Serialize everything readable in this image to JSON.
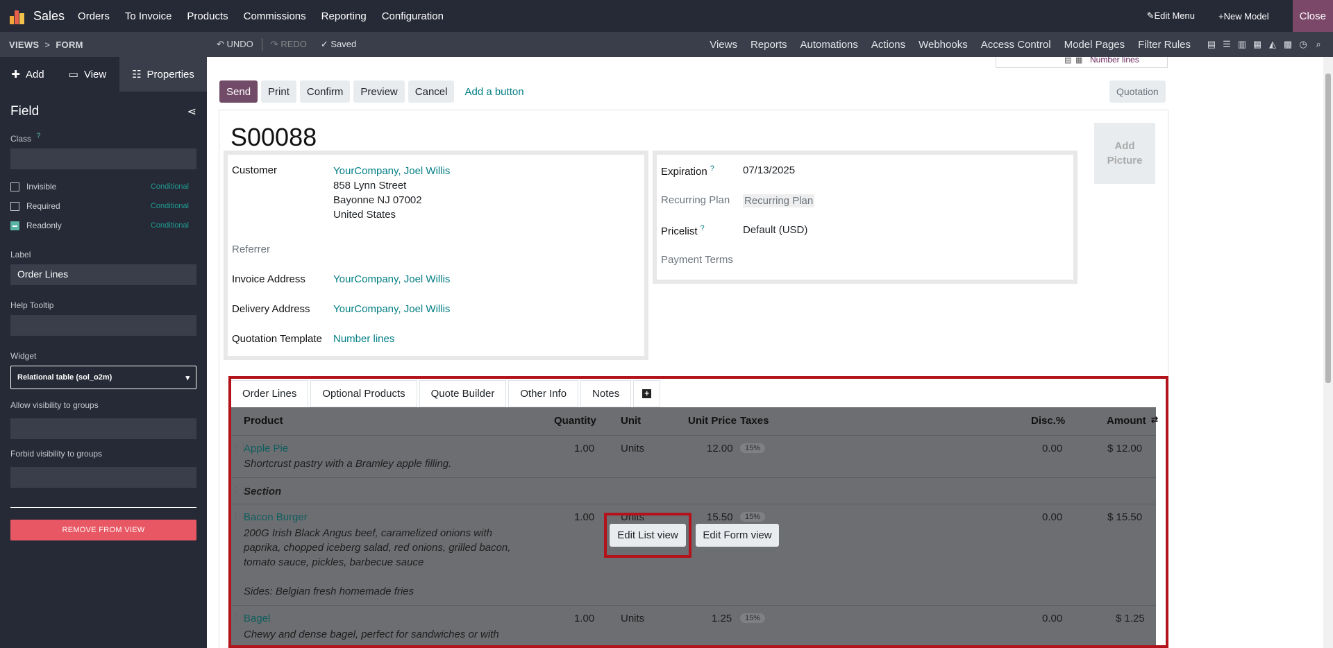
{
  "topbar": {
    "app_name": "Sales",
    "menu": [
      "Orders",
      "To Invoice",
      "Products",
      "Commissions",
      "Reporting",
      "Configuration"
    ],
    "edit_menu": "Edit Menu",
    "new_model": "New Model",
    "close": "Close"
  },
  "secbar": {
    "breadcrumb_views": "VIEWS",
    "breadcrumb_form": "FORM",
    "undo": "UNDO",
    "redo": "REDO",
    "saved": "Saved",
    "menu": [
      "Views",
      "Reports",
      "Automations",
      "Actions",
      "Webhooks",
      "Access Control",
      "Model Pages",
      "Filter Rules"
    ],
    "view_icons": [
      "form-view-icon",
      "list-view-icon",
      "kanban-view-icon",
      "calendar-view-icon",
      "graph-view-icon",
      "pivot-view-icon",
      "activity-view-icon",
      "search-view-icon"
    ]
  },
  "sidebar": {
    "tabs": {
      "add": "Add",
      "view": "View",
      "properties": "Properties"
    },
    "title": "Field",
    "class_label": "Class",
    "class_tip": "?",
    "invisible": "Invisible",
    "required": "Required",
    "readonly": "Readonly",
    "conditional": "Conditional",
    "label_label": "Label",
    "label_value": "Order Lines",
    "help_label": "Help Tooltip",
    "widget_label": "Widget",
    "widget_value": "Relational table (sol_o2m)",
    "allow_groups": "Allow visibility to groups",
    "forbid_groups": "Forbid visibility to groups",
    "remove_button": "REMOVE FROM VIEW"
  },
  "form": {
    "stat_button": "Number lines",
    "buttons": {
      "send": "Send",
      "print": "Print",
      "confirm": "Confirm",
      "preview": "Preview",
      "cancel": "Cancel",
      "add_button": "Add a button"
    },
    "status": "Quotation",
    "name": "S00088",
    "add_picture": "Add Picture",
    "customer_label": "Customer",
    "customer_name": "YourCompany, Joel Willis",
    "customer_street": "858 Lynn Street",
    "customer_city": "Bayonne NJ 07002",
    "customer_country": "United States",
    "referrer_label": "Referrer",
    "invoice_label": "Invoice Address",
    "invoice_value": "YourCompany, Joel Willis",
    "delivery_label": "Delivery Address",
    "delivery_value": "YourCompany, Joel Willis",
    "template_label": "Quotation Template",
    "template_value": "Number lines",
    "expiration_label": "Expiration",
    "expiration_value": "07/13/2025",
    "recurring_label": "Recurring Plan",
    "recurring_value": "Recurring Plan",
    "pricelist_label": "Pricelist",
    "pricelist_value": "Default (USD)",
    "payment_label": "Payment Terms",
    "tip": "?"
  },
  "notebook": {
    "tabs": [
      "Order Lines",
      "Optional Products",
      "Quote Builder",
      "Other Info",
      "Notes"
    ],
    "add_tab": "+"
  },
  "table": {
    "headers": {
      "product": "Product",
      "quantity": "Quantity",
      "unit": "Unit",
      "unit_price": "Unit Price",
      "taxes": "Taxes",
      "disc": "Disc.%",
      "amount": "Amount"
    },
    "rows": [
      {
        "product": "Apple Pie",
        "desc1": "Shortcrust pastry with a Bramley apple filling.",
        "qty": "1.00",
        "unit": "Units",
        "price": "12.00",
        "tax": "15%",
        "disc": "0.00",
        "amount": "$ 12.00"
      },
      {
        "section": "Section"
      },
      {
        "product": "Bacon Burger",
        "desc1": "200G Irish Black Angus beef, caramelized onions with",
        "desc2": "paprika, chopped iceberg salad, red onions, grilled bacon,",
        "desc3": "tomato sauce, pickles, barbecue sauce",
        "desc4": "Sides: Belgian fresh homemade fries",
        "qty": "1.00",
        "unit": "Units",
        "price": "15.50",
        "tax": "15%",
        "disc": "0.00",
        "amount": "$ 15.50"
      },
      {
        "product": "Bagel",
        "desc1": "Chewy and dense bagel, perfect for sandwiches or with",
        "qty": "1.00",
        "unit": "Units",
        "price": "1.25",
        "tax": "15%",
        "disc": "0.00",
        "amount": "$ 1.25"
      }
    ],
    "edit_list": "Edit List view",
    "edit_form": "Edit Form view"
  }
}
